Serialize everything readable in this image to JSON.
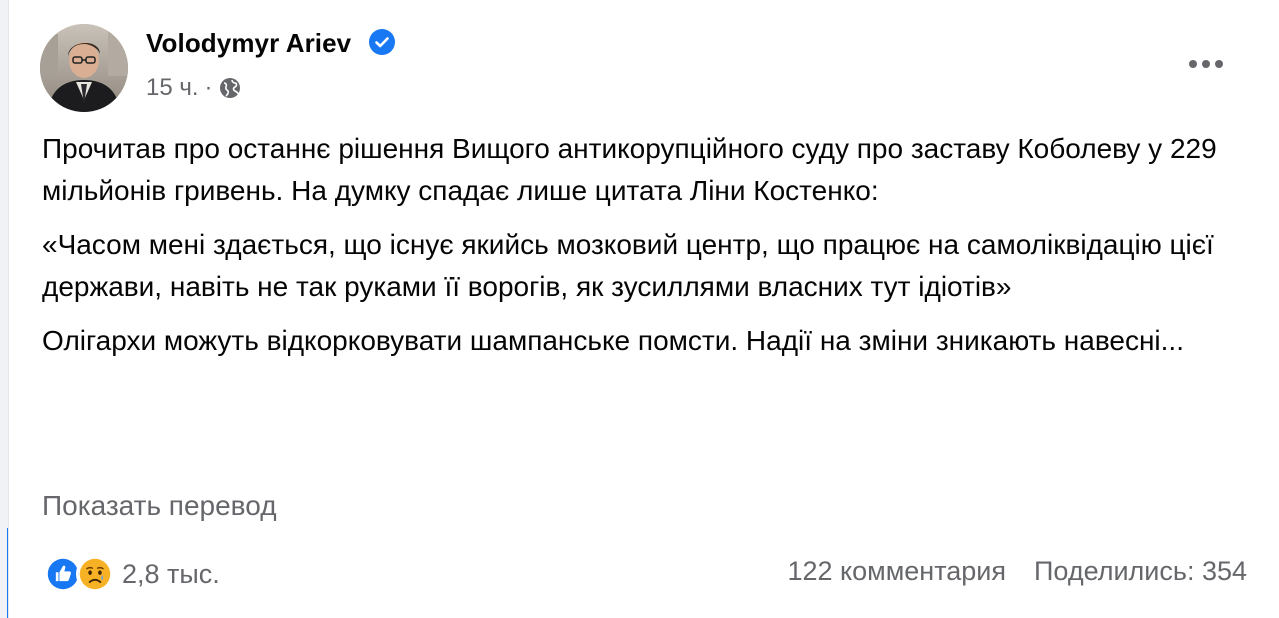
{
  "post": {
    "author": "Volodymyr Ariev",
    "time": "15 ч.",
    "separator": "·",
    "paragraphs": [
      "Прочитав про останнє рішення Вищого антикорупційного суду про заставу Коболеву у 229 мільйонів гривень. На думку спадає лише цитата Ліни Костенко:",
      "«Часом мені здається, що існує якийсь мозковий центр, що працює на самоліквідацію цієї держави, навіть не так руками її ворогів, як зусиллями власних тут ідіотів»",
      "Олігархи можуть відкорковувати шампанське помсти. Надії на зміни зникають навесні..."
    ],
    "translate_label": "Показать перевод"
  },
  "footer": {
    "reactions_count": "2,8 тыс.",
    "comments": "122 комментария",
    "shares": "Поделились: 354"
  },
  "icons": {
    "verified": "verified-badge-icon",
    "privacy": "globe-icon",
    "more": "more-dots-icon",
    "like": "like-reaction-icon",
    "sad": "sad-reaction-icon"
  },
  "colors": {
    "accent": "#1877f2",
    "text": "#050505",
    "secondary": "#65676b",
    "sad_yellow": "#f7b125"
  }
}
